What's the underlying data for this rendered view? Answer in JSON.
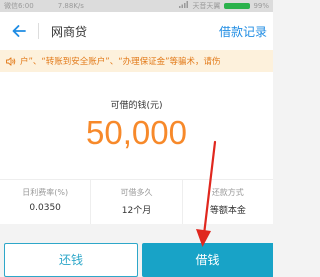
{
  "status_bar": {
    "left": "微信6:00",
    "speed": "7.88K/s",
    "carrier": "天音天翼",
    "battery": "99%"
  },
  "nav": {
    "title": "网商贷",
    "action": "借款记录"
  },
  "notice": {
    "text": "户”、“转账到安全账户”、“办理保证金”等骗术，请伤"
  },
  "loan": {
    "amount_label": "可借的钱(元)",
    "amount_value": "50,000",
    "terms": [
      {
        "label": "日利费率(%)",
        "value": "0.0350"
      },
      {
        "label": "可借多久",
        "value": "12个月"
      },
      {
        "label": "还款方式",
        "value": "等额本金"
      }
    ]
  },
  "buttons": {
    "repay_label": "还钱",
    "borrow_label": "借钱"
  },
  "colors": {
    "accent_blue": "#1f8ce3",
    "primary_button": "#18a3c7",
    "amount_orange": "#f7892a",
    "notice_text": "#e27a1a",
    "notice_bg": "#fdf1dc",
    "annotation_red": "#e0271e"
  },
  "icons": {
    "back": "arrow-left-icon",
    "notice": "speaker-icon",
    "signal": "signal-icon"
  }
}
